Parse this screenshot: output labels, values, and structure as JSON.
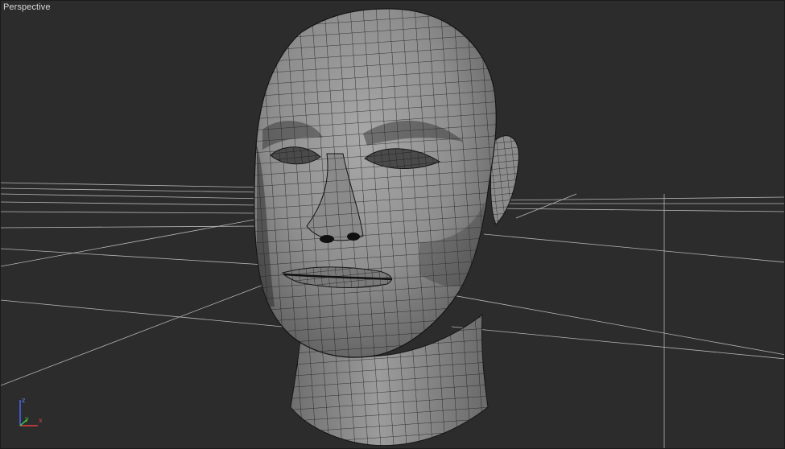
{
  "viewport": {
    "label": "Perspective",
    "view_type": "perspective",
    "background_color": "#2c2c2c",
    "grid_color": "#d0d0d0",
    "mesh_color": "#9a9a9a",
    "wire_color": "#151515"
  },
  "gizmo": {
    "axis_z": "z",
    "axis_y": "y",
    "axis_x": "x",
    "colors": {
      "x": "#e04040",
      "y": "#40d040",
      "z": "#4a6cff"
    }
  },
  "model": {
    "subject": "head-mesh",
    "render_mode": "smooth-shaded-with-edged-faces"
  }
}
